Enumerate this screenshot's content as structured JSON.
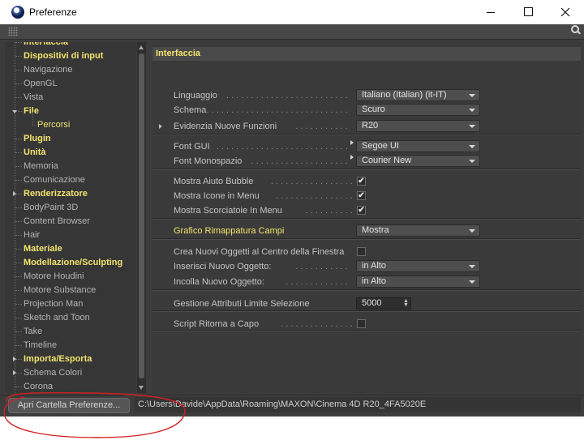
{
  "window": {
    "title": "Preferenze",
    "icon": "cinema4d-icon",
    "controls": [
      "minimize",
      "maximize",
      "close"
    ]
  },
  "sidebar": {
    "items": [
      {
        "label": "Interfaccia",
        "highlight": true
      },
      {
        "label": "Dispositivi di input",
        "highlight": true
      },
      {
        "label": "Navigazione",
        "highlight": false
      },
      {
        "label": "OpenGL",
        "highlight": false
      },
      {
        "label": "Vista",
        "highlight": false
      },
      {
        "label": "File",
        "highlight": true,
        "expanded": true
      },
      {
        "label": "Percorsi",
        "highlight": true,
        "child": true
      },
      {
        "label": "Plugin",
        "highlight": true
      },
      {
        "label": "Unità",
        "highlight": true
      },
      {
        "label": "Memoria",
        "highlight": false
      },
      {
        "label": "Comunicazione",
        "highlight": false
      },
      {
        "label": "Renderizzatore",
        "highlight": true,
        "collapsed": true
      },
      {
        "label": "BodyPaint 3D",
        "highlight": false
      },
      {
        "label": "Content Browser",
        "highlight": false
      },
      {
        "label": "Hair",
        "highlight": false
      },
      {
        "label": "Materiale",
        "highlight": true
      },
      {
        "label": "Modellazione/Sculpting",
        "highlight": true
      },
      {
        "label": "Motore Houdini",
        "highlight": false
      },
      {
        "label": "Motore Substance",
        "highlight": false
      },
      {
        "label": "Projection Man",
        "highlight": false
      },
      {
        "label": "Sketch and Toon",
        "highlight": false
      },
      {
        "label": "Take",
        "highlight": false
      },
      {
        "label": "Timeline",
        "highlight": false
      },
      {
        "label": "Importa/Esporta",
        "highlight": true,
        "collapsed": true
      },
      {
        "label": "Schema Colori",
        "highlight": false,
        "collapsed": true
      },
      {
        "label": "Corona",
        "highlight": false
      }
    ]
  },
  "content": {
    "header": "Interfaccia",
    "rows": [
      {
        "label": "Linguaggio",
        "type": "dropdown",
        "value": "Italiano (Italian) (it-IT)"
      },
      {
        "label": "Schema",
        "type": "dropdown",
        "value": "Scuro"
      },
      {
        "label": "Evidenzia Nuove Funzioni",
        "type": "dropdown",
        "value": "R20",
        "expandable": true
      },
      {
        "label": "Font GUI",
        "type": "dropdown",
        "value": "Segoe UI",
        "pointer": true
      },
      {
        "label": "Font Monospazio",
        "type": "dropdown",
        "value": "Courier New",
        "pointer": true
      },
      {
        "label": "Mostra Aiuto Bubble",
        "type": "checkbox",
        "checked": true
      },
      {
        "label": "Mostra Icone in Menu",
        "type": "checkbox",
        "checked": true
      },
      {
        "label": "Mostra Scorciatoie In Menu",
        "type": "checkbox",
        "checked": true
      },
      {
        "label": "Grafico Rimappatura Campi",
        "type": "dropdown",
        "value": "Mostra",
        "highlight": true
      },
      {
        "label": "Crea Nuovi Oggetti al Centro della Finestra",
        "type": "checkbox",
        "checked": false
      },
      {
        "label": "Inserisci Nuovo Oggetto:",
        "type": "dropdown",
        "value": "in Alto"
      },
      {
        "label": "Incolla Nuovo Oggetto:",
        "type": "dropdown",
        "value": "in Alto"
      },
      {
        "label": "Gestione Attributi Limite Selezione",
        "type": "number",
        "value": "5000"
      },
      {
        "label": "Script Ritorna a Capo",
        "type": "checkbox",
        "checked": false
      }
    ]
  },
  "footer": {
    "open_button": "Apri Cartella Preferenze...",
    "path": "C:\\Users\\Davide\\AppData\\Roaming\\MAXON\\Cinema 4D R20_4FA5020E"
  },
  "colors": {
    "background": "#3c3c3c",
    "highlight_text": "#f3e36d",
    "annotation": "#d42020"
  }
}
